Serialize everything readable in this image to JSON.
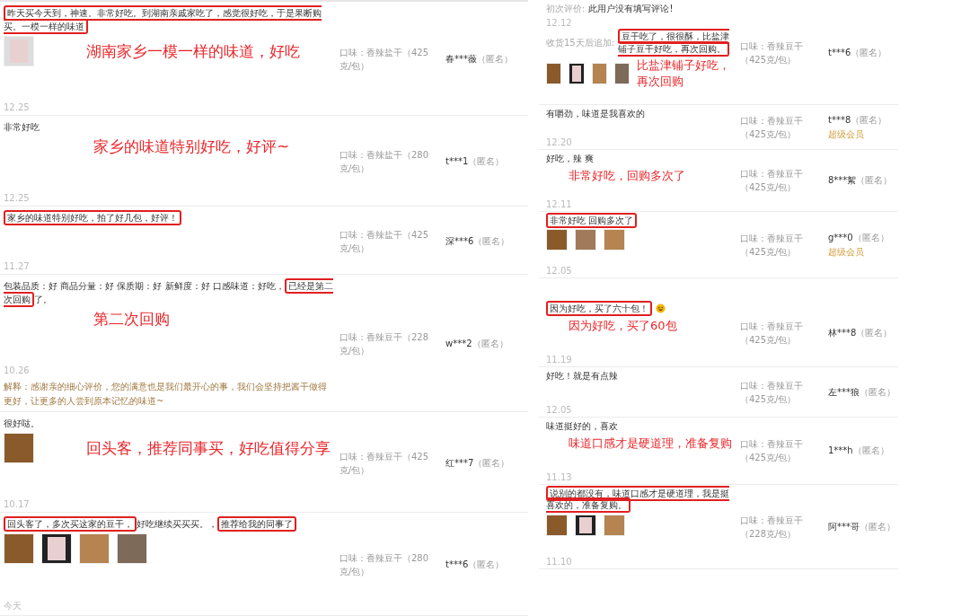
{
  "left_panel": {
    "reviews": [
      {
        "segments": [
          {
            "text": "昨天买今天到，神速。非常好吃。到湖南亲戚家吃了，感觉很好吃，于是果断购买。一模一样的味道",
            "boxed": true
          }
        ],
        "photos": [
          {
            "kind": "package"
          }
        ],
        "annotation": "湖南家乡一模一样的味道，好吃",
        "date": "12.25",
        "flavor": "口味：香辣盐干（425克/包）",
        "user": "春***薇",
        "anon": "（匿名）"
      },
      {
        "segments": [
          {
            "text": "非常好吃",
            "boxed": false
          }
        ],
        "annotation": "家乡的味道特别好吃，好评~",
        "date": "12.25",
        "flavor": "口味：香辣盐干（280克/包）",
        "user": "t***1",
        "anon": "（匿名）"
      },
      {
        "segments": [
          {
            "text": "家乡的味道特别好吃，拍了好几包，好评！",
            "boxed": true
          }
        ],
        "date": "11.27",
        "flavor": "口味：香辣盐干（425克/包）",
        "user": "深***6",
        "anon": "（匿名）"
      },
      {
        "segments": [
          {
            "text": "包装品质：好 商品分量：好 保质期：好 新鲜度：好 口感味道：好吃，",
            "boxed": false
          },
          {
            "text": "已经是第二次回购",
            "boxed": true
          },
          {
            "text": "了。",
            "boxed": false
          }
        ],
        "annotation": "第二次回购",
        "date": "10.26",
        "reply": "解释：感谢亲的细心评价，您的满意也是我们最开心的事，我们会坚持把酱干做得更好，让更多的人尝到原本记忆的味道~",
        "flavor": "口味：香辣豆干（228克/包）",
        "user": "w***2",
        "anon": "（匿名）"
      },
      {
        "segments": [
          {
            "text": "很好哒。",
            "boxed": false
          }
        ],
        "photos": [
          {
            "kind": "food"
          }
        ],
        "date": "10.17",
        "annotation": "回头客，推荐同事买，好吃值得分享",
        "flavor": "口味：香辣豆干（425克/包）",
        "user": "红***7",
        "anon": "（匿名）"
      },
      {
        "segments": [
          {
            "text": "回头客了，多次买这家的豆干，",
            "boxed": true
          },
          {
            "text": "好吃继续买买买。，",
            "boxed": false
          },
          {
            "text": "推荐给我的同事了",
            "boxed": true
          }
        ],
        "photos": [
          {
            "kind": "food"
          },
          {
            "kind": "package"
          },
          {
            "kind": "food"
          },
          {
            "kind": "food"
          }
        ],
        "date": "今天",
        "flavor": "口味：香辣豆干（280克/包）",
        "user": "t***6",
        "anon": "（匿名）"
      }
    ]
  },
  "right_panels": [
    {
      "reviews": [
        {
          "first": {
            "label": "初次评价:",
            "text": "此用户没有填写评论!",
            "date": "12.12"
          },
          "label": "收货15天后追加:",
          "segments": [
            {
              "text": "豆干吃了，很很酥，比盐津铺子豆干好吃，再次回购。",
              "boxed": true
            }
          ],
          "photos": [
            {
              "kind": "food"
            },
            {
              "kind": "package"
            },
            {
              "kind": "food"
            },
            {
              "kind": "food"
            }
          ],
          "annotation": "比盐津铺子好吃，再次回购",
          "flavor": "口味：香辣豆干（425克/包）",
          "user": "t***6",
          "anon": "（匿名）"
        },
        {
          "segments": [
            {
              "text": "有嚼劲，味道是我喜欢的",
              "boxed": false
            }
          ],
          "date": "12.20",
          "flavor": "口味：香辣豆干（425克/包）",
          "user": "t***8",
          "anon": "（匿名）",
          "badge": "超级会员"
        },
        {
          "segments": [
            {
              "text": "好吃，辣 爽",
              "boxed": false
            }
          ],
          "date": "12.11",
          "annotation": "非常好吃，回购多次了",
          "flavor": "口味：香辣豆干（425克/包）",
          "user": "8***絮",
          "anon": "（匿名）"
        },
        {
          "segments": [
            {
              "text": "非常好吃 回购多次了",
              "boxed": true
            }
          ],
          "photos": [
            {
              "kind": "food"
            },
            {
              "kind": "food"
            },
            {
              "kind": "food"
            }
          ],
          "date": "12.05",
          "flavor": "口味：香辣豆干（425克/包）",
          "user": "g***0",
          "anon": "（匿名）",
          "badge": "超级会员"
        }
      ]
    },
    {
      "reviews": [
        {
          "segments": [
            {
              "text": "因为好吃，买了六十包！",
              "boxed": true
            }
          ],
          "emoji_icon": true,
          "annotation": "因为好吃，买了60包",
          "date": "11.19",
          "flavor": "口味：香辣豆干（425克/包）",
          "user": "林***8",
          "anon": "（匿名）"
        },
        {
          "segments": [
            {
              "text": "好吃！就是有点辣",
              "boxed": false
            }
          ],
          "date": "12.05",
          "flavor": "口味：香辣豆干（425克/包）",
          "user": "左***狼",
          "anon": "（匿名）"
        },
        {
          "segments": [
            {
              "text": "味道挺好的，喜欢",
              "boxed": false
            }
          ],
          "date": "11.13",
          "annotation": "味道口感才是硬道理，准备复购",
          "flavor": "口味：香辣豆干（425克/包）",
          "user": "1***h",
          "anon": "（匿名）"
        },
        {
          "segments": [
            {
              "text": "说别的都没有，味道口感才是硬道理，我是挺喜欢的，准备复购。",
              "boxed": true
            }
          ],
          "photos": [
            {
              "kind": "food"
            },
            {
              "kind": "package"
            },
            {
              "kind": "food"
            }
          ],
          "date": "11.10",
          "flavor": "口味：香辣豆干（228克/包）",
          "user": "阿***哥",
          "anon": "（匿名）"
        }
      ]
    }
  ]
}
